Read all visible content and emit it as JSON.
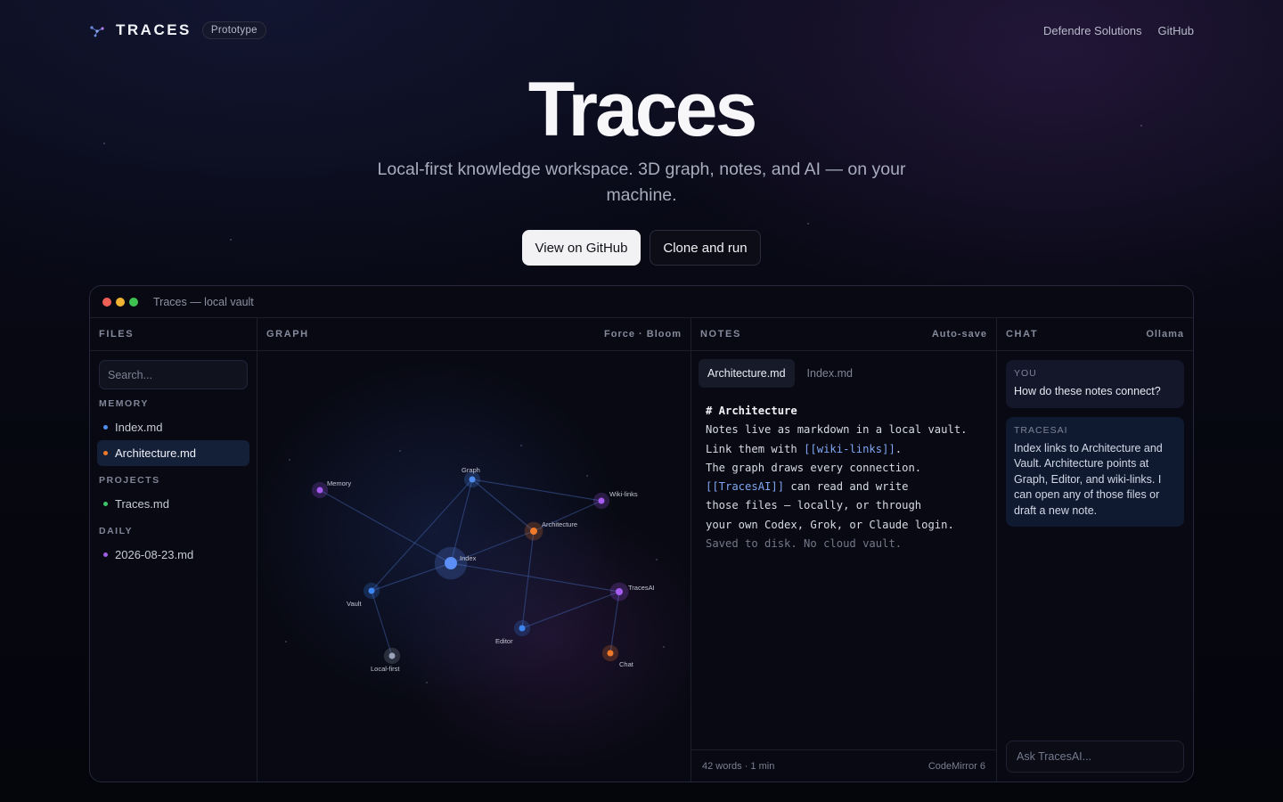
{
  "nav": {
    "brand": "TRACES",
    "badge": "Prototype",
    "links": [
      "Defendre Solutions",
      "GitHub"
    ]
  },
  "hero": {
    "title": "Traces",
    "subtitle": "Local-first knowledge workspace. 3D graph, notes, and AI — on your machine.",
    "cta_primary": "View on GitHub",
    "cta_secondary": "Clone and run"
  },
  "window": {
    "title": "Traces — local vault",
    "files": {
      "header": "FILES",
      "search_placeholder": "Search...",
      "sections": [
        {
          "label": "MEMORY",
          "items": [
            {
              "name": "Index.md",
              "color": "#4f8df0",
              "active": false
            },
            {
              "name": "Architecture.md",
              "color": "#f07a2a",
              "active": true
            }
          ]
        },
        {
          "label": "PROJECTS",
          "items": [
            {
              "name": "Traces.md",
              "color": "#3cc46b",
              "active": false
            }
          ]
        },
        {
          "label": "DAILY",
          "items": [
            {
              "name": "2026-08-23.md",
              "color": "#a05ee8",
              "active": false
            }
          ]
        }
      ]
    },
    "graph": {
      "header": "GRAPH",
      "mode": "Force · Bloom",
      "nodes": [
        {
          "id": "Memory",
          "color": "#a65cf0"
        },
        {
          "id": "Graph",
          "color": "#4f8df0"
        },
        {
          "id": "Wiki-links",
          "color": "#a65cf0"
        },
        {
          "id": "Architecture",
          "color": "#f07a2a"
        },
        {
          "id": "Index",
          "color": "#5b8ff5"
        },
        {
          "id": "Vault",
          "color": "#3d86f0"
        },
        {
          "id": "TracesAI",
          "color": "#a65cf0"
        },
        {
          "id": "Editor",
          "color": "#3d86f0"
        },
        {
          "id": "Local-first",
          "color": "#9aa3b8"
        },
        {
          "id": "Chat",
          "color": "#f07a2a"
        }
      ]
    },
    "notes": {
      "header": "NOTES",
      "status": "Auto-save",
      "tabs": [
        "Architecture.md",
        "Index.md"
      ],
      "lines": {
        "l1": "# Architecture",
        "l2": "Notes live as markdown in a local vault.",
        "l3a": "Link them with ",
        "l3b": "[[wiki-links]]",
        "l3c": ".",
        "l4": "The graph draws every connection.",
        "l5a": "[[TracesAI]]",
        "l5b": " can read and write",
        "l6": "those files — locally, or through",
        "l7": "your own Codex, Grok, or Claude login.",
        "l8": "Saved to disk. No cloud vault."
      },
      "footer_left": "42 words · 1 min",
      "footer_right": "CodeMirror 6"
    },
    "chat": {
      "header": "CHAT",
      "provider": "Ollama",
      "you_label": "YOU",
      "you_msg": "How do these notes connect?",
      "ai_label": "TRACESAI",
      "ai_msg": "Index links to Architecture and Vault. Architecture points at Graph, Editor, and wiki-links. I can open any of those files or draft a new note.",
      "input_placeholder": "Ask TracesAI..."
    }
  }
}
